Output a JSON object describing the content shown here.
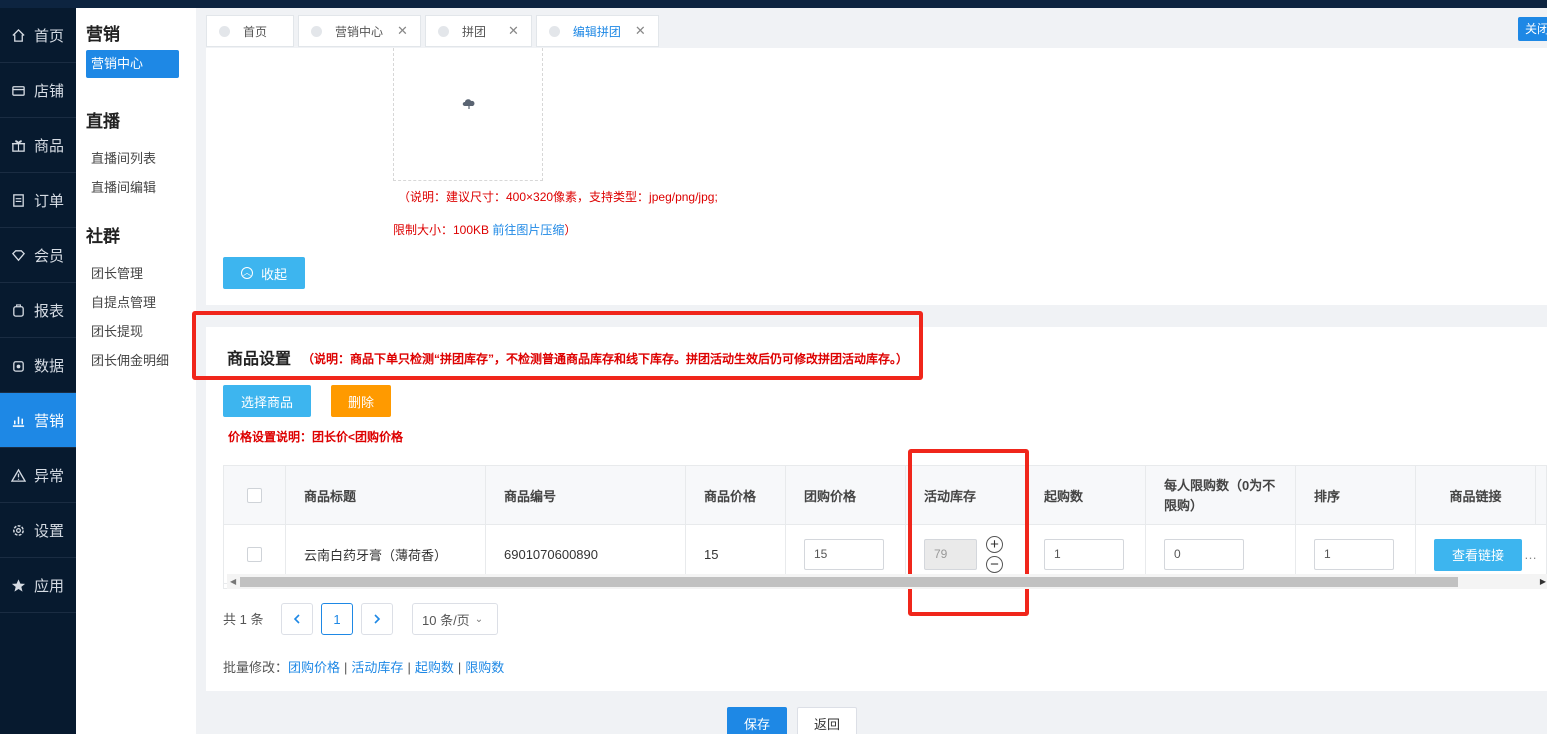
{
  "nav": {
    "items": [
      {
        "label": "首页",
        "icon": "home-icon"
      },
      {
        "label": "店铺",
        "icon": "store-icon"
      },
      {
        "label": "商品",
        "icon": "gift-icon"
      },
      {
        "label": "订单",
        "icon": "order-icon"
      },
      {
        "label": "会员",
        "icon": "diamond-icon"
      },
      {
        "label": "报表",
        "icon": "report-icon"
      },
      {
        "label": "数据",
        "icon": "data-icon"
      },
      {
        "label": "营销",
        "icon": "chart-icon"
      },
      {
        "label": "异常",
        "icon": "warning-icon"
      },
      {
        "label": "设置",
        "icon": "gear-icon"
      },
      {
        "label": "应用",
        "icon": "star-icon"
      }
    ],
    "active": "营销"
  },
  "subnav": {
    "groups": [
      {
        "title": "营销",
        "items": [
          "营销中心"
        ]
      },
      {
        "title": "直播",
        "items": [
          "直播间列表",
          "直播间编辑"
        ]
      },
      {
        "title": "社群",
        "items": [
          "团长管理",
          "自提点管理",
          "团长提现",
          "团长佣金明细"
        ]
      }
    ]
  },
  "tabs": [
    {
      "label": "首页",
      "closable": false
    },
    {
      "label": "营销中心",
      "closable": true
    },
    {
      "label": "拼团",
      "closable": true
    },
    {
      "label": "编辑拼团",
      "closable": true
    }
  ],
  "close_all": "关闭",
  "upload": {
    "note_line1": "（说明：建议尺寸：400×320像素，支持类型：jpeg/png/jpg;",
    "note_line2": "限制大小：100KB",
    "compress_link": "前往图片压缩",
    "note_end": "）",
    "collapse_label": "收起"
  },
  "goods": {
    "title": "商品设置",
    "note": "（说明：商品下单只检测“拼团库存”，不检测普通商品库存和线下库存。拼团活动生效后仍可修改拼团活动库存。）",
    "select_label": "选择商品",
    "delete_label": "删除",
    "price_note": "价格设置说明：团长价<团购价格",
    "columns": [
      "商品标题",
      "商品编号",
      "商品价格",
      "团购价格",
      "活动库存",
      "起购数",
      "每人限购数（0为不限购）",
      "排序",
      "商品链接"
    ],
    "rows": [
      {
        "title": "云南白药牙膏（薄荷香）",
        "code": "6901070600890",
        "price": "15",
        "group_price": "15",
        "stock": "79",
        "min_buy": "1",
        "limit": "0",
        "sort": "1",
        "link_label": "查看链接"
      }
    ]
  },
  "pager": {
    "total": "共 1 条",
    "current": "1",
    "page_size": "10 条/页"
  },
  "batch": {
    "prefix": "批量修改：",
    "links": [
      "团购价格",
      "活动库存",
      "起购数",
      "限购数"
    ]
  },
  "footer": {
    "save_label": "保存",
    "back_label": "返回"
  },
  "colors": {
    "primary": "#1e88e5",
    "info": "#3db5ef",
    "warning": "#ff9a00",
    "danger": "#d00000",
    "annotation": "#f0261b"
  }
}
